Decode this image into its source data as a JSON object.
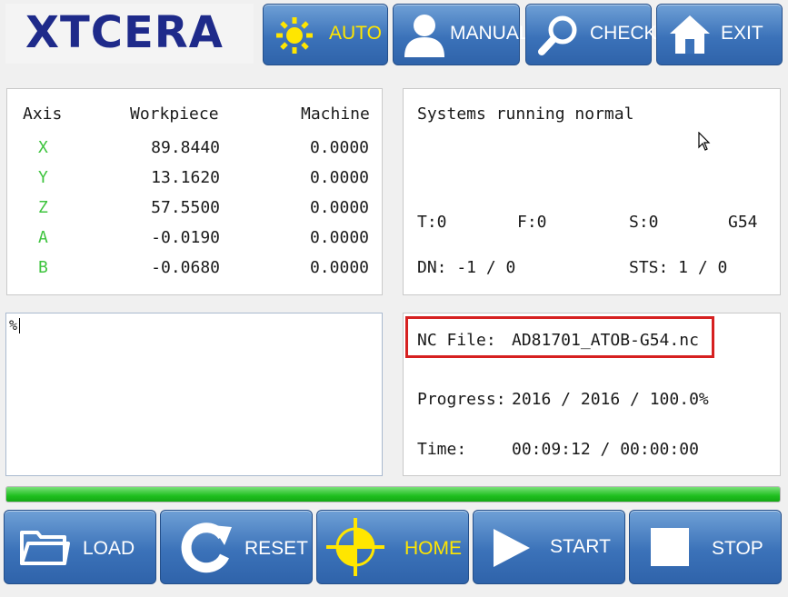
{
  "brand": {
    "logo_text": "XTCERA"
  },
  "top_buttons": [
    {
      "label": "AUTO",
      "icon": "sun-icon"
    },
    {
      "label": "MANUAL",
      "icon": "user-icon"
    },
    {
      "label": "CHECK",
      "icon": "magnifier-icon"
    },
    {
      "label": "EXIT",
      "icon": "home-icon"
    }
  ],
  "axes_panel": {
    "headers": {
      "axis": "Axis",
      "workpiece": "Workpiece",
      "machine": "Machine"
    },
    "rows": [
      {
        "axis": "X",
        "workpiece": "89.8440",
        "machine": "0.0000"
      },
      {
        "axis": "Y",
        "workpiece": "13.1620",
        "machine": "0.0000"
      },
      {
        "axis": "Z",
        "workpiece": "57.5500",
        "machine": "0.0000"
      },
      {
        "axis": "A",
        "workpiece": "-0.0190",
        "machine": "0.0000"
      },
      {
        "axis": "B",
        "workpiece": "-0.0680",
        "machine": "0.0000"
      }
    ]
  },
  "status_panel": {
    "message": "Systems running normal",
    "t": "T:0",
    "f": "F:0",
    "s": "S:0",
    "coord": "G54",
    "dn": "DN: -1 / 0",
    "sts": "STS: 1 / 0"
  },
  "editor": {
    "content": "%"
  },
  "file_panel": {
    "nc_file_label": "NC File:",
    "nc_file_name": "AD81701_ATOB-G54.nc",
    "progress_label": "Progress:",
    "progress_value": "2016 / 2016 / 100.0%",
    "time_label": "Time:",
    "time_value": "00:09:12 / 00:00:00"
  },
  "progress_bar": {
    "fraction": 1.0,
    "color": "#1fbf1f"
  },
  "bottom_buttons": [
    {
      "label": "LOAD",
      "icon": "folder-icon"
    },
    {
      "label": "RESET",
      "icon": "refresh-icon"
    },
    {
      "label": "HOME",
      "icon": "crosshair-icon"
    },
    {
      "label": "START",
      "icon": "play-icon"
    },
    {
      "label": "STOP",
      "icon": "stop-icon"
    }
  ],
  "colors": {
    "button_blue": "#3b72b9",
    "axis_green": "#3ec43e",
    "highlight_red": "#d62020",
    "accent_yellow": "#ffe600"
  }
}
